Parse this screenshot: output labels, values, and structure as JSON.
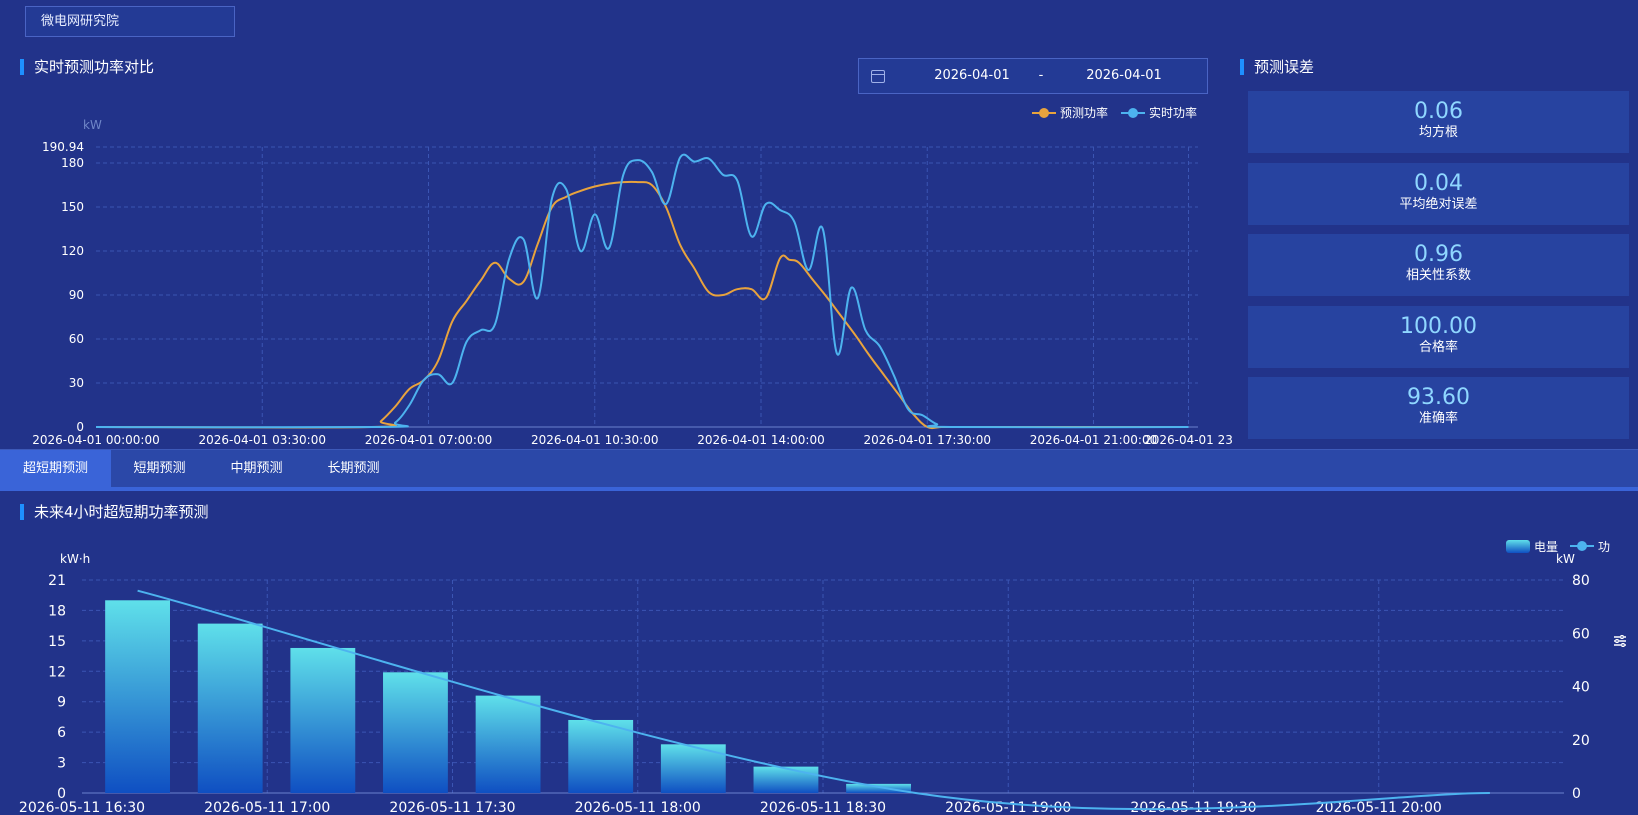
{
  "station": "微电网研究院",
  "top": {
    "title": "实时预测功率对比",
    "date_start": "2026-04-01",
    "date_sep": "-",
    "date_end": "2026-04-01",
    "calendar_icon": "calendar-icon"
  },
  "errors": {
    "title": "预测误差",
    "items": [
      {
        "value": "0.06",
        "label": "均方根"
      },
      {
        "value": "0.04",
        "label": "平均绝对误差"
      },
      {
        "value": "0.96",
        "label": "相关性系数"
      },
      {
        "value": "100.00",
        "label": "合格率"
      },
      {
        "value": "93.60",
        "label": "准确率"
      }
    ]
  },
  "tabs": [
    {
      "label": "超短期预测",
      "active": true
    },
    {
      "label": "短期预测",
      "active": false
    },
    {
      "label": "中期预测",
      "active": false
    },
    {
      "label": "长期预测",
      "active": false
    }
  ],
  "bottom": {
    "title": "未来4小时超短期功率预测",
    "settings_icon": "sliders-icon"
  },
  "colors": {
    "background": "#22338a",
    "forecast_line": "#e8a33d",
    "actual_line": "#4db3ef",
    "bar_top": "#5fe0ea",
    "bar_bottom": "#0f4fc2",
    "accent": "#1e90ff"
  },
  "chart_data": [
    {
      "type": "line",
      "ylabel": "kW",
      "ylim": [
        0,
        190.94
      ],
      "yticks": [
        "0",
        "30",
        "60",
        "90",
        "120",
        "150",
        "180",
        "190.94"
      ],
      "ytick_values": [
        0,
        30,
        60,
        90,
        120,
        150,
        180,
        190.94
      ],
      "xlim": [
        0,
        23.2
      ],
      "xticks": [
        "2026-04-01 00:00:00",
        "2026-04-01 03:30:00",
        "2026-04-01 07:00:00",
        "2026-04-01 10:30:00",
        "2026-04-01 14:00:00",
        "2026-04-01 17:30:00",
        "2026-04-01 21:00:00",
        "2026-04-01 23"
      ],
      "xtick_values": [
        0,
        3.5,
        7,
        10.5,
        14,
        17.5,
        21,
        23
      ],
      "grid": true,
      "legend": "top-right",
      "series": [
        {
          "name": "预测功率",
          "x": [
            0,
            5.8,
            6.0,
            6.3,
            6.6,
            6.9,
            7.2,
            7.5,
            7.8,
            8.1,
            8.4,
            8.7,
            9.0,
            9.3,
            9.6,
            9.9,
            10.2,
            10.5,
            10.8,
            11.1,
            11.4,
            11.7,
            12.0,
            12.3,
            12.6,
            12.9,
            13.2,
            13.5,
            13.8,
            14.1,
            14.4,
            14.6,
            14.8,
            15.1,
            15.4,
            15.7,
            16.0,
            16.3,
            16.6,
            16.9,
            17.2,
            17.5,
            17.8,
            18.1,
            23.0
          ],
          "y": [
            0,
            0,
            4,
            14,
            26,
            32,
            45,
            72,
            86,
            100,
            112,
            101,
            99,
            125,
            150,
            157,
            161,
            164,
            166,
            167,
            167,
            165,
            150,
            124,
            108,
            92,
            90,
            94,
            94,
            88,
            115,
            114,
            112,
            100,
            88,
            75,
            62,
            48,
            35,
            22,
            9,
            0,
            0,
            0,
            0
          ]
        },
        {
          "name": "实时功率",
          "x": [
            0,
            6.0,
            6.3,
            6.6,
            6.9,
            7.2,
            7.5,
            7.8,
            8.1,
            8.4,
            8.7,
            9.0,
            9.3,
            9.6,
            9.9,
            10.2,
            10.5,
            10.8,
            11.1,
            11.4,
            11.7,
            12.0,
            12.3,
            12.6,
            12.9,
            13.2,
            13.5,
            13.8,
            14.1,
            14.4,
            14.7,
            15.0,
            15.3,
            15.6,
            15.9,
            16.2,
            16.5,
            16.8,
            17.1,
            17.4,
            17.7,
            18.0,
            23.0
          ],
          "y": [
            0,
            0,
            3,
            15,
            32,
            36,
            30,
            58,
            66,
            70,
            115,
            128,
            88,
            156,
            162,
            120,
            145,
            122,
            172,
            182,
            174,
            152,
            184,
            181,
            183,
            172,
            168,
            130,
            152,
            148,
            140,
            107,
            135,
            50,
            95,
            66,
            55,
            35,
            12,
            8,
            2,
            0,
            0
          ]
        }
      ]
    },
    {
      "type": "bar",
      "ylabel": "kW·h",
      "y2label": "kW",
      "ylim": [
        0,
        21
      ],
      "y2lim": [
        0,
        80
      ],
      "yticks": [
        "0",
        "3",
        "6",
        "9",
        "12",
        "15",
        "18",
        "21"
      ],
      "ytick_values": [
        0,
        3,
        6,
        9,
        12,
        15,
        18,
        21
      ],
      "y2ticks": [
        "0",
        "20",
        "40",
        "60",
        "80"
      ],
      "y2tick_values": [
        0,
        20,
        40,
        60,
        80
      ],
      "xlim": [
        0,
        4
      ],
      "xticks": [
        "2026-05-11 16:30",
        "2026-05-11 17:00",
        "2026-05-11 17:30",
        "2026-05-11 18:00",
        "2026-05-11 18:30",
        "2026-05-11 19:00",
        "2026-05-11 19:30",
        "2026-05-11 20:00"
      ],
      "xtick_values": [
        0,
        0.5,
        1,
        1.5,
        2,
        2.5,
        3,
        3.5
      ],
      "grid": true,
      "legend": "top-right",
      "series": [
        {
          "name": "电量",
          "axis": "left",
          "x": [
            0.15,
            0.4,
            0.65,
            0.9,
            1.15,
            1.4,
            1.65,
            1.9,
            2.15
          ],
          "values": [
            19.0,
            16.7,
            14.3,
            11.9,
            9.6,
            7.2,
            4.8,
            2.6,
            0.9
          ]
        },
        {
          "name": "功率",
          "axis": "right",
          "x": [
            0.15,
            2.25,
            3.8
          ],
          "values": [
            76,
            0,
            0
          ]
        }
      ]
    }
  ]
}
